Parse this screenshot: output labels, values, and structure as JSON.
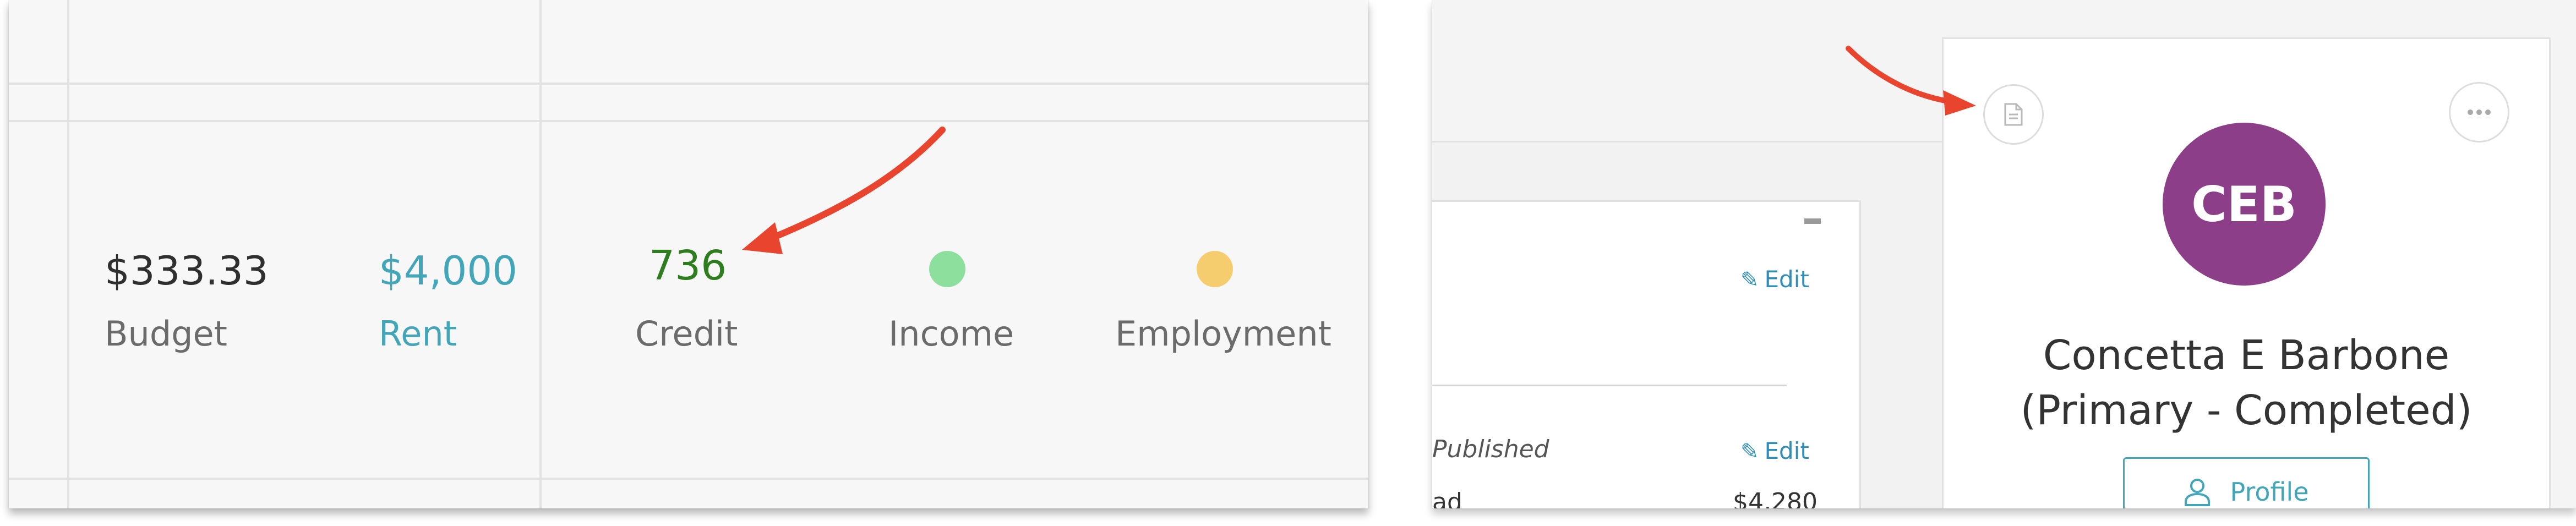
{
  "metrics": {
    "budget": {
      "value": "$333.33",
      "label": "Budget"
    },
    "rent": {
      "value": "$4,000",
      "label": "Rent"
    },
    "credit": {
      "value": "736",
      "label": "Credit"
    },
    "income": {
      "label": "Income",
      "status_color": "#8ddf9d"
    },
    "employment": {
      "label": "Employment",
      "status_color": "#f6cd6e"
    }
  },
  "details": {
    "edit_label_1": "Edit",
    "published_text": "Published",
    "edit_label_2": "Edit",
    "row_partial_label": "ad",
    "row_partial_value": "$4,280"
  },
  "profile_card": {
    "initials": "CEB",
    "name": "Concetta E Barbone",
    "status": "(Primary - Completed)",
    "profile_button": "Profile",
    "avatar_color": "#8c3f88",
    "accent_color": "#42a5b8"
  },
  "annotations": {
    "arrow_color": "#e8442e"
  }
}
